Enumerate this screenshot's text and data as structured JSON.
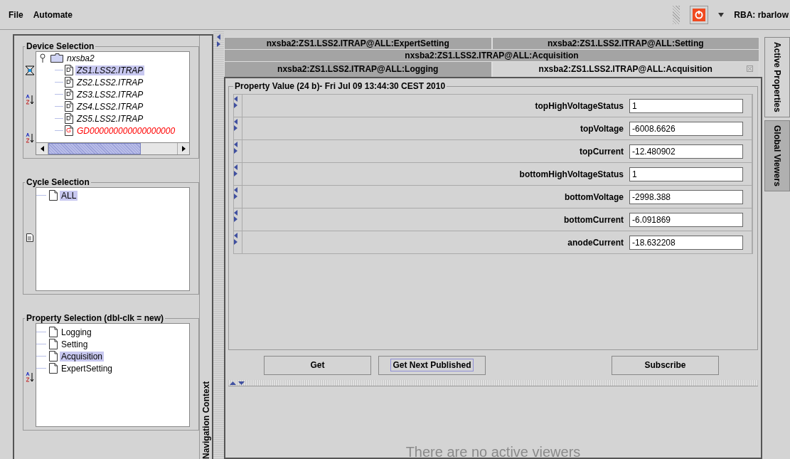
{
  "menu": [
    "File",
    "Automate"
  ],
  "user": "RBA: rbarlow",
  "device_selection": {
    "title": "Device Selection",
    "root": {
      "label": "nxsba2",
      "expanded": true,
      "children": [
        {
          "label": "ZS1.LSS2.ITRAP",
          "badge": "D",
          "color": "#000000",
          "selected": true
        },
        {
          "label": "ZS2.LSS2.ITRAP",
          "badge": "D",
          "color": "#000000",
          "selected": false
        },
        {
          "label": "ZS3.LSS2.ITRAP",
          "badge": "D",
          "color": "#000000",
          "selected": false
        },
        {
          "label": "ZS4.LSS2.ITRAP",
          "badge": "D",
          "color": "#000000",
          "selected": false
        },
        {
          "label": "ZS5.LSS2.ITRAP",
          "badge": "D",
          "color": "#000000",
          "selected": false
        },
        {
          "label": "GD000000000000000000",
          "badge": "G",
          "color": "#ff0000",
          "selected": false
        }
      ]
    }
  },
  "cycle_selection": {
    "title": "Cycle Selection",
    "items": [
      {
        "label": "ALL",
        "selected": true
      }
    ]
  },
  "property_selection": {
    "title": "Property Selection (dbl-clk = new)",
    "items": [
      {
        "label": "Logging",
        "selected": false
      },
      {
        "label": "Setting",
        "selected": false
      },
      {
        "label": "Acquisition",
        "selected": true
      },
      {
        "label": "ExpertSetting",
        "selected": false
      }
    ]
  },
  "navigation_context": "Navigation Context",
  "tab_rows": [
    [
      {
        "label": "nxsba2:ZS1.LSS2.ITRAP@ALL:ExpertSetting",
        "selected": false
      },
      {
        "label": "nxsba2:ZS1.LSS2.ITRAP@ALL:Setting",
        "selected": false
      }
    ],
    [
      {
        "label": "nxsba2:ZS1.LSS2.ITRAP@ALL:Acquisition",
        "selected": false
      }
    ],
    [
      {
        "label": "nxsba2:ZS1.LSS2.ITRAP@ALL:Logging",
        "selected": false
      },
      {
        "label": "nxsba2:ZS1.LSS2.ITRAP@ALL:Acquisition",
        "selected": true
      }
    ]
  ],
  "property_panel": {
    "title": "Property Value (24 b)- Fri Jul 09 13:44:30 CEST 2010",
    "fields": [
      {
        "name": "topHighVoltageStatus",
        "value": "1"
      },
      {
        "name": "topVoltage",
        "value": "-6008.6626"
      },
      {
        "name": "topCurrent",
        "value": "-12.480902"
      },
      {
        "name": "bottomHighVoltageStatus",
        "value": "1"
      },
      {
        "name": "bottomVoltage",
        "value": "-2998.388"
      },
      {
        "name": "bottomCurrent",
        "value": "-6.091869"
      },
      {
        "name": "anodeCurrent",
        "value": "-18.632208"
      }
    ]
  },
  "buttons": [
    {
      "label": "Get",
      "focused": false
    },
    {
      "label": "Get Next Published",
      "focused": true
    },
    {
      "label": "Subscribe",
      "focused": false
    }
  ],
  "viewers_message": "There are no active viewers",
  "side_tabs": [
    {
      "label": "Active Properties",
      "selected": true
    },
    {
      "label": "Global Viewers",
      "selected": false
    }
  ]
}
